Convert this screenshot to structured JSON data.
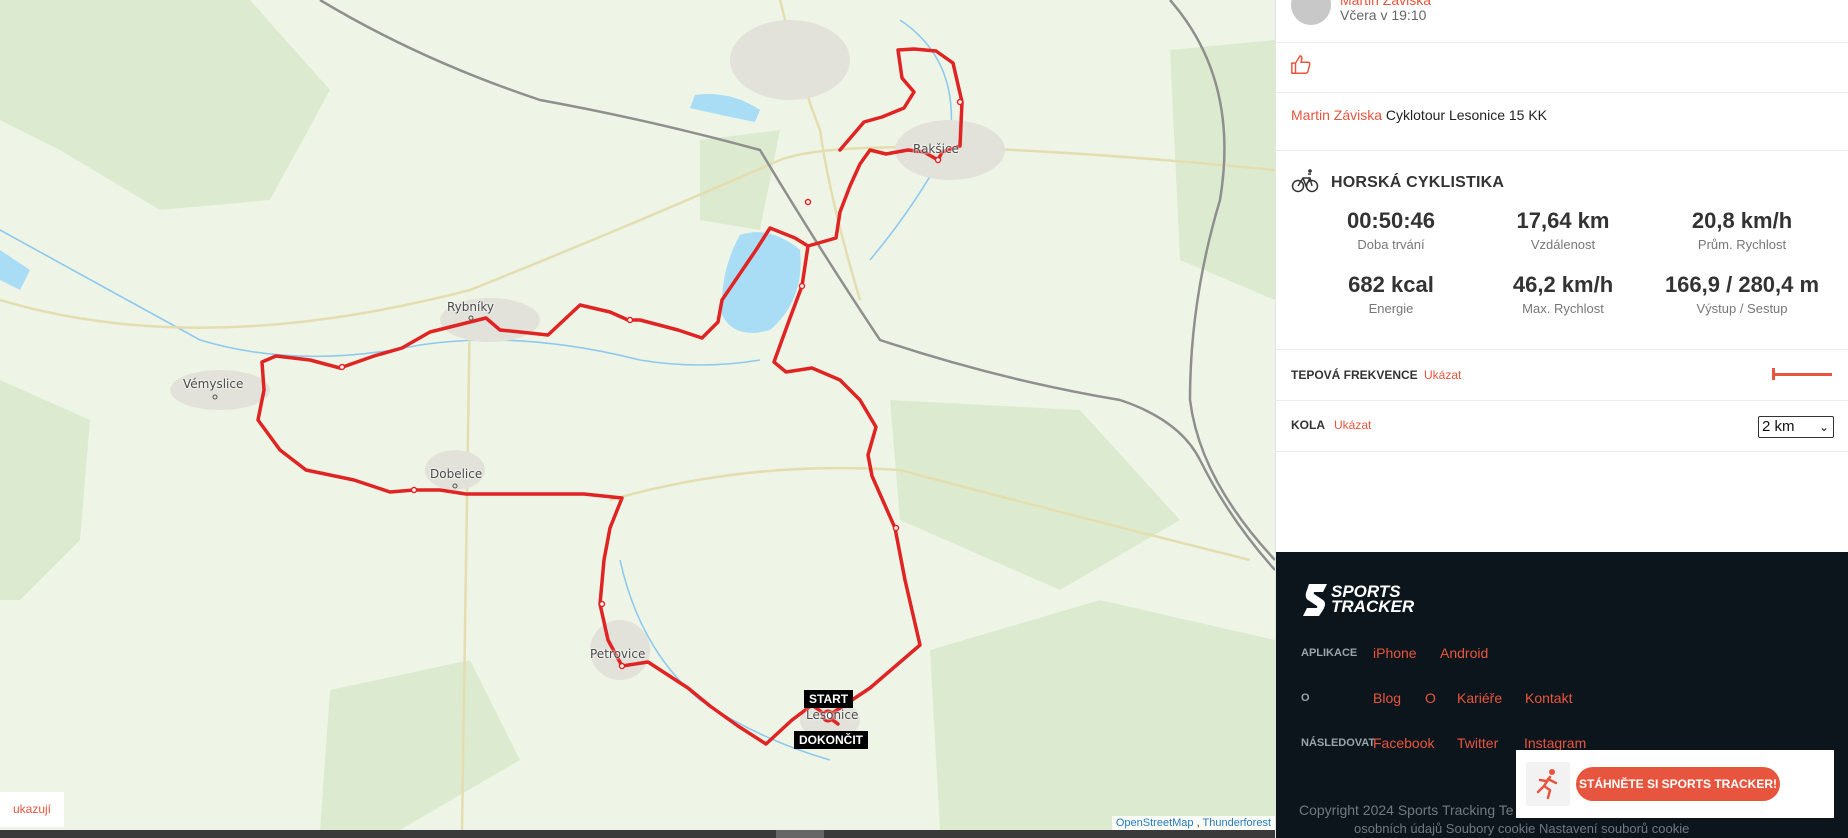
{
  "map": {
    "places": [
      "Rakšice",
      "Rybníky",
      "Vémyslice",
      "Dobelice",
      "Petrovice",
      "Lesonice"
    ],
    "start_label": "START",
    "finish_label": "DOKONČIT",
    "show_label": "ukazují",
    "attribution": {
      "osm": "OpenStreetMap",
      "sep": ",",
      "tf": "Thunderforest"
    },
    "route_color": "#e02323"
  },
  "post": {
    "author_top": "Martin Záviska",
    "time": "Včera v 19:10",
    "title_author": "Martin Záviska",
    "title": "Cyklotour Lesonice 15 KK"
  },
  "activity": {
    "sport": "HORSKÁ CYKLISTIKA",
    "stats": [
      {
        "value": "00:50:46",
        "label": "Doba trvání"
      },
      {
        "value": "17,64  km",
        "label": "Vzdálenost"
      },
      {
        "value": "20,8  km/h",
        "label": "Prům. Rychlost"
      },
      {
        "value": "682 kcal",
        "label": "Energie"
      },
      {
        "value": "46,2  km/h",
        "label": "Max. Rychlost"
      },
      {
        "value": "166,9 / 280,4  m",
        "label": "Výstup / Sestup"
      }
    ]
  },
  "heart_rate": {
    "label": "TEPOVÁ FREKVENCE",
    "show": "Ukázat"
  },
  "laps": {
    "label": "KOLA",
    "show": "Ukázat",
    "selected": "2 km"
  },
  "footer": {
    "logo_line1": "SPORTS",
    "logo_line2": "TRACKER",
    "apps_label": "APLIKACE",
    "apps": [
      "iPhone",
      "Android"
    ],
    "about_label": "O",
    "about": [
      "Blog",
      "O",
      "Kariéře",
      "Kontakt"
    ],
    "follow_label": "NÁSLEDOVAT",
    "follow": [
      "Facebook",
      "Twitter",
      "Instagram"
    ],
    "copyright": "Copyright 2024 Sports Tracking Te",
    "cookie_text": "osobních údajů Soubory   cookie    Nastavení souborů cookie",
    "promo_button": "STÁHNĚTE SI SPORTS TRACKER!"
  },
  "colors": {
    "accent": "#e8553e",
    "footer_bg": "#0c151b"
  }
}
